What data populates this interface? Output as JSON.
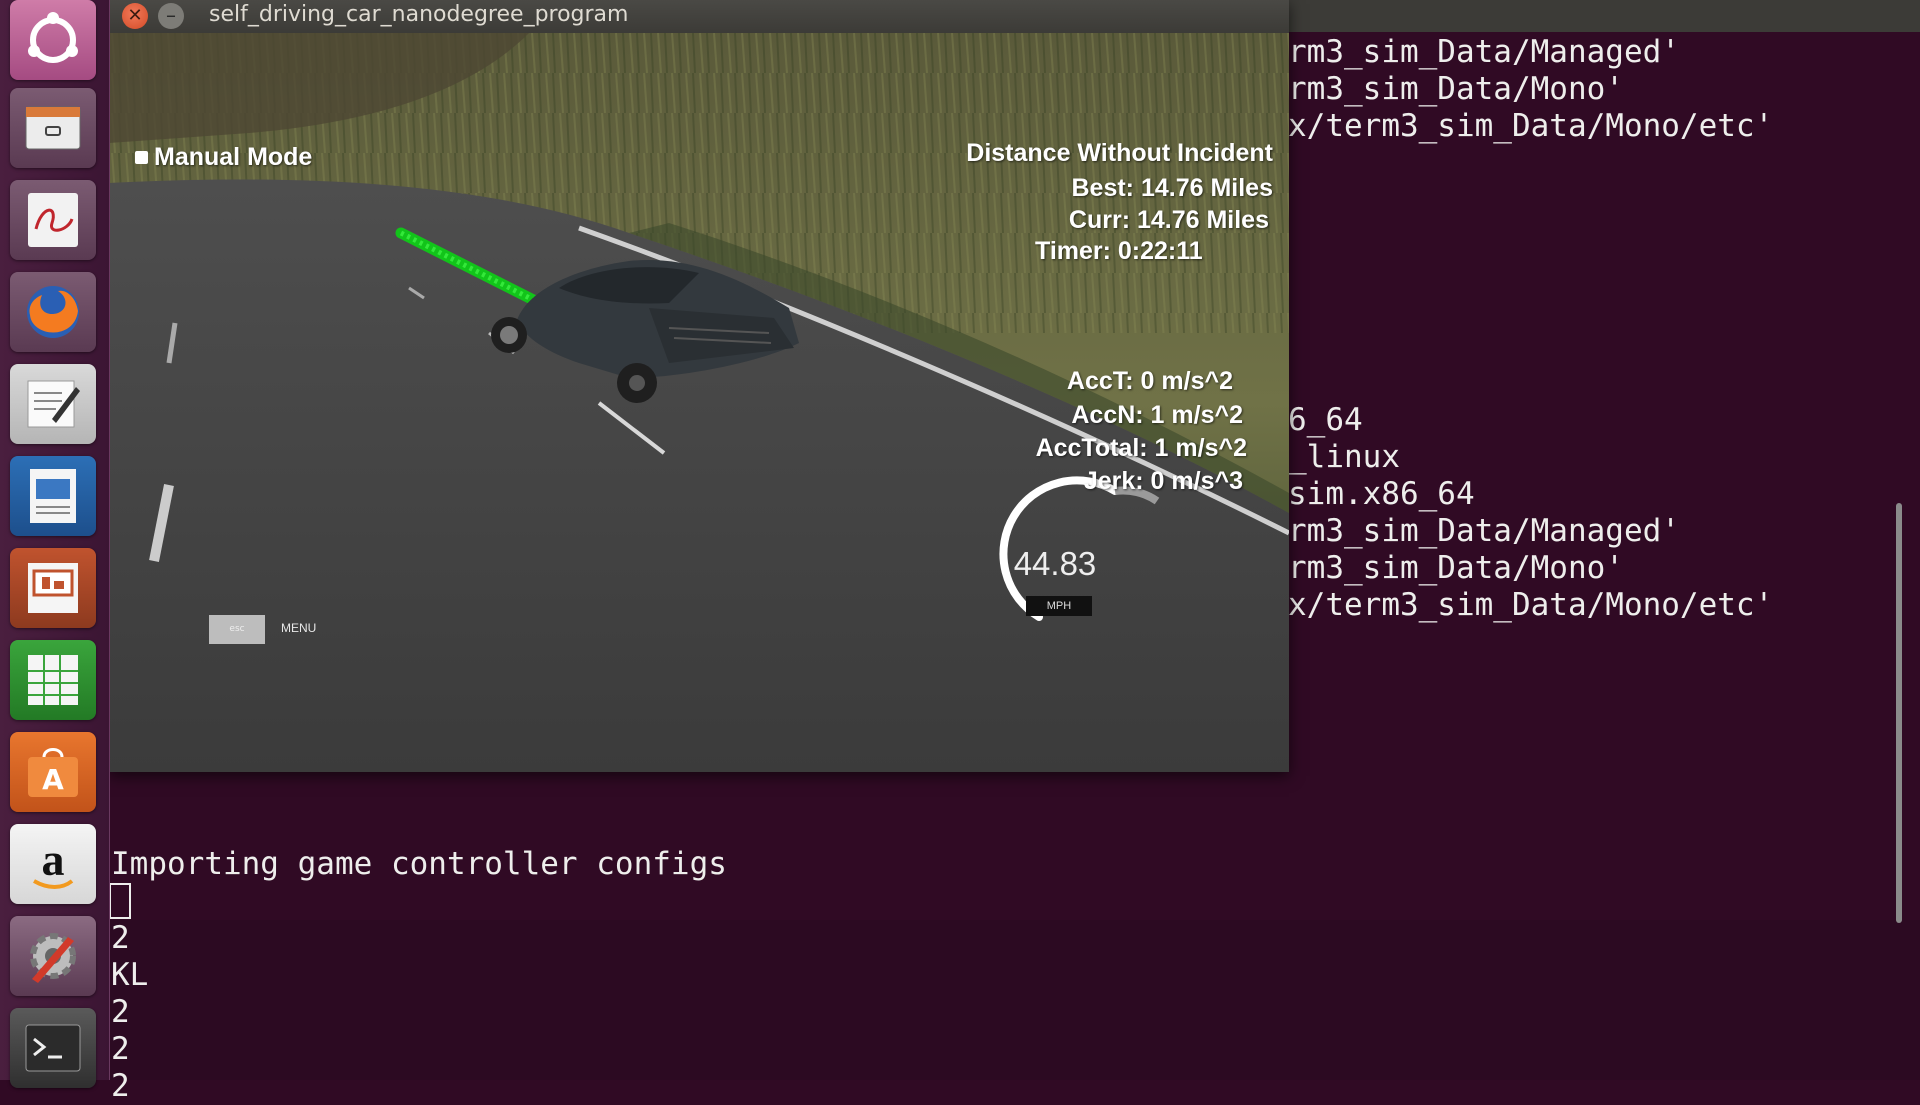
{
  "simulator": {
    "title": "self_driving_car_nanodegree_program",
    "mode": "Manual Mode",
    "distance_heading": "Distance Without Incident",
    "best": "Best: 14.76 Miles",
    "curr": "Curr: 14.76 Miles",
    "timer": "Timer: 0:22:11",
    "acc_t": "AccT: 0 m/s^2",
    "acc_n": "AccN: 1 m/s^2",
    "acc_total": "AccTotal: 1 m/s^2",
    "jerk": "Jerk: 0 m/s^3",
    "speed": "44.83",
    "speed_unit": "MPH",
    "menu_label": "MENU",
    "esc_label": "esc"
  },
  "terminal": {
    "right_lines_top": [
      "rm3_sim_Data/Managed'",
      "rm3_sim_Data/Mono'",
      "x/term3_sim_Data/Mono/etc'"
    ],
    "right_lines_mid": [
      "6_64",
      "_linux",
      "sim.x86_64",
      "rm3_sim_Data/Managed'",
      "rm3_sim_Data/Mono'",
      "x/term3_sim_Data/Mono/etc'"
    ],
    "import_line": "Importing game controller configs",
    "bottom_lines": [
      "2",
      "KL",
      "2",
      "2",
      "2"
    ]
  },
  "launcher": {
    "items": [
      "ubuntu-dash-icon",
      "files-icon",
      "document-viewer-icon",
      "firefox-icon",
      "text-editor-icon",
      "libreoffice-writer-icon",
      "libreoffice-impress-icon",
      "libreoffice-calc-icon",
      "software-center-icon",
      "amazon-icon",
      "system-settings-icon",
      "terminal-icon"
    ]
  }
}
